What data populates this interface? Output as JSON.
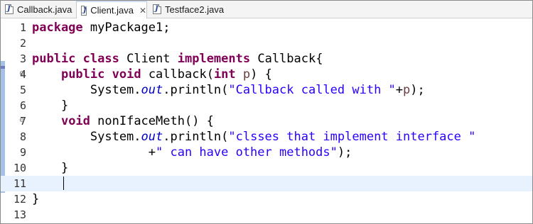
{
  "tabs": [
    {
      "label": "Callback.java",
      "active": false
    },
    {
      "label": "Client.java",
      "active": true
    },
    {
      "label": "Testface2.java",
      "active": false
    }
  ],
  "tab_close_glyph": "✕",
  "file_icon_letter": "J",
  "lines": [
    {
      "num": "1",
      "tokens": [
        {
          "t": "package",
          "c": "kw"
        },
        {
          "t": " myPackage1;"
        }
      ]
    },
    {
      "num": "2",
      "tokens": []
    },
    {
      "num": "3",
      "tokens": [
        {
          "t": "public",
          "c": "kw"
        },
        {
          "t": " "
        },
        {
          "t": "class",
          "c": "kw"
        },
        {
          "t": " Client "
        },
        {
          "t": "implements",
          "c": "kw"
        },
        {
          "t": " Callback{"
        }
      ]
    },
    {
      "num": "4",
      "fold": true,
      "tokens": [
        {
          "t": "    "
        },
        {
          "t": "public",
          "c": "kw"
        },
        {
          "t": " "
        },
        {
          "t": "void",
          "c": "kw"
        },
        {
          "t": " callback("
        },
        {
          "t": "int",
          "c": "kw"
        },
        {
          "t": " "
        },
        {
          "t": "p",
          "c": "par"
        },
        {
          "t": ") {"
        }
      ]
    },
    {
      "num": "5",
      "tokens": [
        {
          "t": "        System."
        },
        {
          "t": "out",
          "c": "fld"
        },
        {
          "t": ".println("
        },
        {
          "t": "\"Callback called with \"",
          "c": "str"
        },
        {
          "t": "+"
        },
        {
          "t": "p",
          "c": "par"
        },
        {
          "t": ");"
        }
      ]
    },
    {
      "num": "6",
      "tokens": [
        {
          "t": "    }"
        }
      ]
    },
    {
      "num": "7",
      "fold": true,
      "tokens": [
        {
          "t": "    "
        },
        {
          "t": "void",
          "c": "kw"
        },
        {
          "t": " nonIfaceMeth() {"
        }
      ]
    },
    {
      "num": "8",
      "tokens": [
        {
          "t": "        System."
        },
        {
          "t": "out",
          "c": "fld"
        },
        {
          "t": ".println("
        },
        {
          "t": "\"clsses that implement interface \"",
          "c": "str"
        }
      ]
    },
    {
      "num": "9",
      "tokens": [
        {
          "t": "                +"
        },
        {
          "t": "\" can have other methods\"",
          "c": "str"
        },
        {
          "t": ");"
        }
      ]
    },
    {
      "num": "10",
      "tokens": [
        {
          "t": "    }"
        }
      ]
    },
    {
      "num": "11",
      "current": true,
      "tokens": []
    },
    {
      "num": "12",
      "tokens": [
        {
          "t": "}"
        }
      ]
    },
    {
      "num": "13",
      "tokens": []
    }
  ],
  "colors": {
    "keyword": "#7f0055",
    "string": "#2a00ff",
    "static_field": "#0000c0",
    "parameter": "#6a3e3e",
    "current_line": "#e8f2fe",
    "change_bar": "#a4c2e6"
  },
  "icons": {
    "file": "java-file-icon",
    "close": "close-icon",
    "fold": "fold-collapse-icon"
  }
}
